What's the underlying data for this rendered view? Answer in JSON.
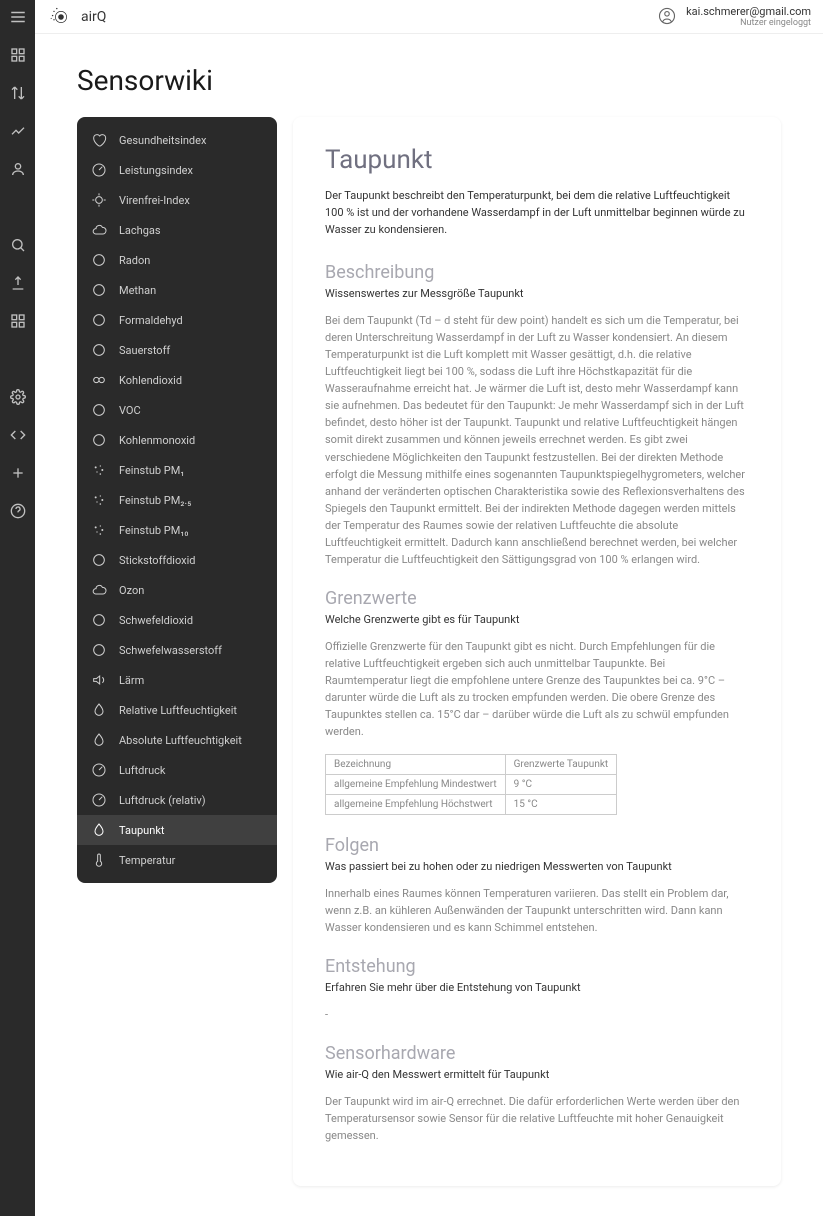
{
  "brand": "airQ",
  "user": {
    "email": "kai.schmerer@gmail.com",
    "sub": "Nutzer eingeloggt"
  },
  "pageTitle": "Sensorwiki",
  "sidebar": [
    {
      "label": "Gesundheitsindex",
      "icon": "heart"
    },
    {
      "label": "Leistungsindex",
      "icon": "gauge"
    },
    {
      "label": "Virenfrei-Index",
      "icon": "virus"
    },
    {
      "label": "Lachgas",
      "icon": "cloud"
    },
    {
      "label": "Radon",
      "icon": "circle"
    },
    {
      "label": "Methan",
      "icon": "circle"
    },
    {
      "label": "Formaldehyd",
      "icon": "circle"
    },
    {
      "label": "Sauerstoff",
      "icon": "circle"
    },
    {
      "label": "Kohlendioxid",
      "icon": "co2"
    },
    {
      "label": "VOC",
      "icon": "circle"
    },
    {
      "label": "Kohlenmonoxid",
      "icon": "circle"
    },
    {
      "label": "Feinstub PM₁",
      "icon": "dust"
    },
    {
      "label": "Feinstub PM₂.₅",
      "icon": "dust"
    },
    {
      "label": "Feinstub PM₁₀",
      "icon": "dust"
    },
    {
      "label": "Stickstoffdioxid",
      "icon": "circle"
    },
    {
      "label": "Ozon",
      "icon": "cloud"
    },
    {
      "label": "Schwefeldioxid",
      "icon": "circle"
    },
    {
      "label": "Schwefelwasserstoff",
      "icon": "circle"
    },
    {
      "label": "Lärm",
      "icon": "sound"
    },
    {
      "label": "Relative Luftfeuchtigkeit",
      "icon": "drop"
    },
    {
      "label": "Absolute Luftfeuchtigkeit",
      "icon": "drop"
    },
    {
      "label": "Luftdruck",
      "icon": "gauge"
    },
    {
      "label": "Luftdruck (relativ)",
      "icon": "gauge"
    },
    {
      "label": "Taupunkt",
      "icon": "drop",
      "active": true
    },
    {
      "label": "Temperatur",
      "icon": "thermo"
    }
  ],
  "article": {
    "title": "Taupunkt",
    "intro": "Der Taupunkt beschreibt den Temperaturpunkt, bei dem die relative Luftfeuchtigkeit 100 % ist und der vorhandene Wasserdampf in der Luft unmittelbar beginnen würde zu Wasser zu kondensieren.",
    "h_desc": "Beschreibung",
    "sub_desc": "Wissenswertes zur Messgröße Taupunkt",
    "p_desc": "Bei dem Taupunkt (Td – d steht für dew point) handelt es sich um die Temperatur, bei deren Unterschreitung Wasserdampf in der Luft zu Wasser kondensiert. An diesem Temperaturpunkt ist die Luft komplett mit Wasser gesättigt, d.h. die relative Luftfeuchtigkeit liegt bei 100 %, sodass die Luft ihre Höchstkapazität für die Wasseraufnahme erreicht hat. Je wärmer die Luft ist, desto mehr Wasserdampf kann sie aufnehmen. Das bedeutet für den Taupunkt: Je mehr Wasserdampf sich in der Luft befindet, desto höher ist der Taupunkt. Taupunkt und relative Luftfeuchtigkeit hängen somit direkt zusammen und können jeweils errechnet werden. Es gibt zwei verschiedene Möglichkeiten den Taupunkt festzustellen. Bei der direkten Methode erfolgt die Messung mithilfe eines sogenannten Taupunktspiegelhygrometers, welcher anhand der veränderten optischen Charakteristika sowie des Reflexionsverhaltens des Spiegels den Taupunkt ermittelt. Bei der indirekten Methode dagegen werden mittels der Temperatur des Raumes sowie der relativen Luftfeuchte die absolute Luftfeuchtigkeit ermittelt. Dadurch kann anschließend berechnet werden, bei welcher Temperatur die Luftfeuchtigkeit den Sättigungsgrad von 100 % erlangen wird.",
    "h_limits": "Grenzwerte",
    "sub_limits": "Welche Grenzwerte gibt es für Taupunkt",
    "p_limits": "Offizielle Grenzwerte für den Taupunkt gibt es nicht. Durch Empfehlungen für die relative Luftfeuchtigkeit ergeben sich auch unmittelbar Taupunkte. Bei Raumtemperatur liegt die empfohlene untere Grenze des Taupunktes bei ca. 9°C – darunter würde die Luft als zu trocken empfunden werden. Die obere Grenze des Taupunktes stellen ca. 15°C dar – darüber würde die Luft als zu schwül empfunden werden.",
    "table": {
      "th1": "Bezeichnung",
      "th2": "Grenzwerte Taupunkt",
      "r1c1": "allgemeine Empfehlung Mindestwert",
      "r1c2": "9 °C",
      "r2c1": "allgemeine Empfehlung Höchstwert",
      "r2c2": "15 °C"
    },
    "h_cons": "Folgen",
    "sub_cons": "Was passiert bei zu hohen oder zu niedrigen Messwerten von Taupunkt",
    "p_cons": "Innerhalb eines Raumes können Temperaturen variieren. Das stellt ein Problem dar, wenn z.B. an kühleren Außenwänden der Taupunkt unterschritten wird. Dann kann Wasser kondensieren und es kann Schimmel entstehen.",
    "h_orig": "Entstehung",
    "sub_orig": "Erfahren Sie mehr über die Entstehung von Taupunkt",
    "p_orig": "-",
    "h_hw": "Sensorhardware",
    "sub_hw": "Wie air-Q den Messwert ermittelt für Taupunkt",
    "p_hw": "Der Taupunkt wird im air-Q errechnet. Die dafür erforderlichen Werte werden über den Temperatursensor sowie Sensor für die relative Luftfeuchte mit hoher Genauigkeit gemessen."
  }
}
